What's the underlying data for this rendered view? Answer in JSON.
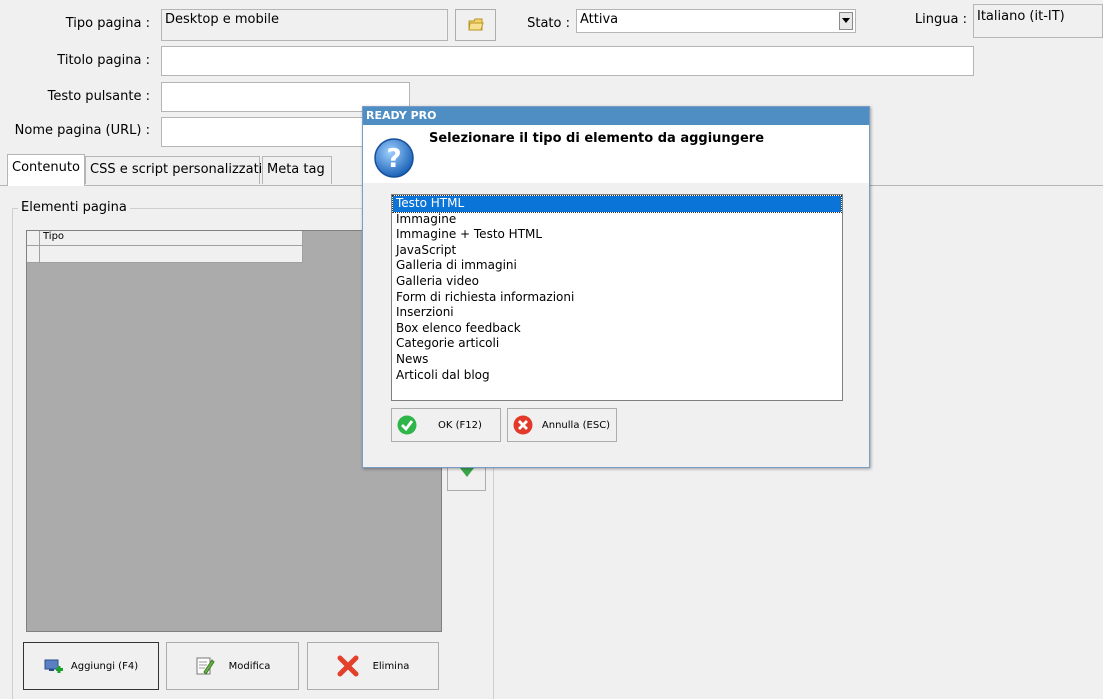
{
  "form": {
    "tipo_pagina_label": "Tipo pagina :",
    "tipo_pagina_value": "Desktop e mobile",
    "stato_label": "Stato :",
    "stato_value": "Attiva",
    "lingua_label": "Lingua :",
    "lingua_value": "Italiano (it-IT)",
    "titolo_label": "Titolo pagina :",
    "titolo_value": "",
    "testo_pulsante_label": "Testo pulsante :",
    "testo_pulsante_value": "",
    "nome_pagina_label": "Nome pagina (URL) :",
    "nome_pagina_value": ""
  },
  "tabs": [
    {
      "label": "Contenuto",
      "active": true
    },
    {
      "label": "CSS e script personalizzati",
      "active": false
    },
    {
      "label": "Meta tag",
      "active": false
    }
  ],
  "elementi": {
    "group_label": "Elementi pagina",
    "column_tipo": "Tipo"
  },
  "bottom_buttons": {
    "aggiungi": "Aggiungi (F4)",
    "modifica": "Modifica",
    "elimina": "Elimina"
  },
  "dialog": {
    "title": "READY PRO",
    "message": "Selezionare il tipo di elemento da aggiungere",
    "items": [
      "Testo HTML",
      "Immagine",
      "Immagine + Testo HTML",
      "JavaScript",
      "Galleria di immagini",
      "Galleria video",
      "Form di richiesta informazioni",
      "Inserzioni",
      "Box elenco feedback",
      "Categorie articoli",
      "News",
      "Articoli dal blog"
    ],
    "selected_index": 0,
    "ok_label": "OK (F12)",
    "annulla_label": "Annulla (ESC)"
  },
  "colors": {
    "selection": "#0a74d8",
    "title_bar": "#4f8ec3"
  }
}
